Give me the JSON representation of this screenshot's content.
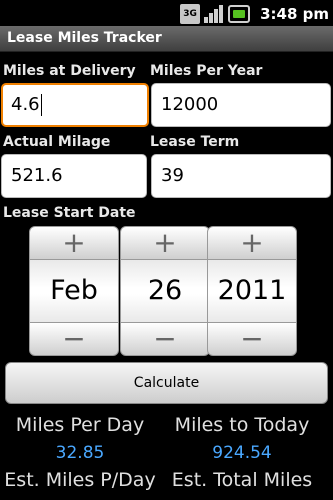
{
  "status_bar": {
    "network": "3G",
    "time": "3:48 pm",
    "icons": [
      "3g-icon",
      "signal-icon",
      "battery-icon"
    ]
  },
  "app": {
    "title": "Lease Miles Tracker"
  },
  "fields": {
    "miles_at_delivery": {
      "label": "Miles at Delivery",
      "value": "4.6"
    },
    "miles_per_year": {
      "label": "Miles Per Year",
      "value": "12000"
    },
    "actual_milage": {
      "label": "Actual Milage",
      "value": "521.6"
    },
    "lease_term": {
      "label": "Lease Term",
      "value": "39"
    }
  },
  "lease_start_date": {
    "label": "Lease Start Date",
    "plus_symbol": "+",
    "minus_symbol": "−",
    "month": "Feb",
    "day": "26",
    "year": "2011"
  },
  "calculate": {
    "label": "Calculate"
  },
  "results": {
    "miles_per_day": {
      "label": "Miles Per Day",
      "value": "32.85"
    },
    "miles_to_today": {
      "label": "Miles to Today",
      "value": "924.54"
    },
    "est_miles_per_day": {
      "label": "Est. Miles P/Day"
    },
    "est_total_miles": {
      "label": "Est. Total Miles"
    }
  },
  "colors": {
    "focus_border": "#f08000",
    "result_value": "#4aa8ff",
    "background": "#000000"
  }
}
